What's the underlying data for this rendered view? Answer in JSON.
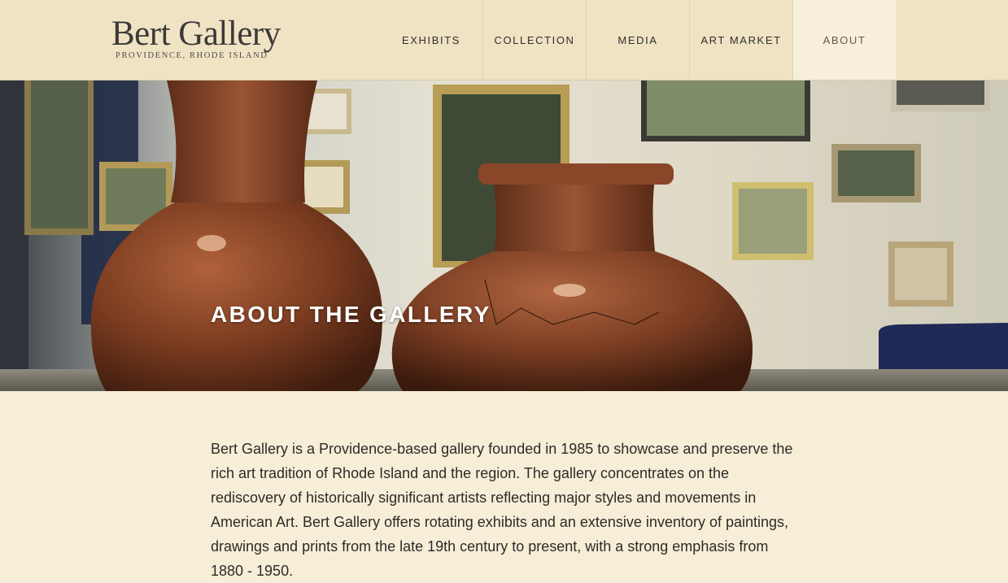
{
  "brand": {
    "title": "Bert Gallery",
    "subtitle": "PROVIDENCE, RHODE ISLAND"
  },
  "nav": {
    "items": [
      {
        "label": "EXHIBITS"
      },
      {
        "label": "COLLECTION"
      },
      {
        "label": "MEDIA"
      },
      {
        "label": "ART MARKET"
      },
      {
        "label": "ABOUT"
      }
    ],
    "active": "ABOUT"
  },
  "hero": {
    "title": "ABOUT THE GALLERY",
    "image": "gallery-interior-with-pottery-vases"
  },
  "intro": {
    "text": "Bert Gallery is a Providence-based gallery founded in 1985 to showcase and preserve the rich art tradition of Rhode Island and the region. The gallery concentrates on the rediscovery of historically significant artists reflecting major styles and movements in American Art. Bert Gallery offers rotating exhibits and an extensive inventory of paintings, drawings and prints from the late 19th century to present, with a strong emphasis from 1880 - 1950."
  },
  "colors": {
    "header_bg": "#efe3c4",
    "page_bg": "#f7eed7",
    "active_nav_bg": "#f7efdc",
    "text": "#2c2b28"
  }
}
